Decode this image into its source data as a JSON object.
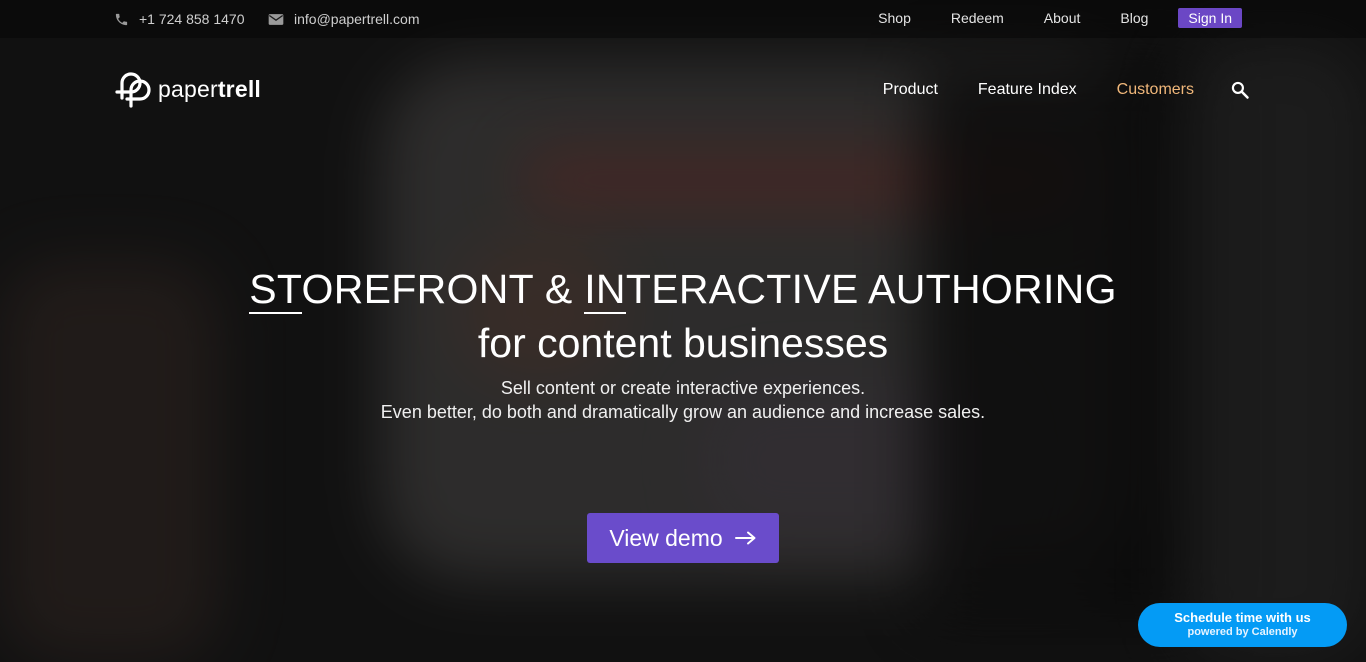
{
  "colors": {
    "accent": "#6a4ccb",
    "active_nav": "#f0b77a",
    "calendly": "#049bf5"
  },
  "topbar": {
    "phone": {
      "icon": "phone-icon",
      "text": "+1 724 858 1470"
    },
    "email": {
      "icon": "mail-icon",
      "text": "info@papertrell.com"
    },
    "links": [
      "Shop",
      "Redeem",
      "About",
      "Blog"
    ],
    "sign_in": "Sign In"
  },
  "nav": {
    "logo_text_light": "paper",
    "logo_text_bold": "trell",
    "items": [
      "Product",
      "Feature Index",
      "Customers"
    ],
    "active_item": "Customers",
    "search_icon": "search-icon"
  },
  "hero": {
    "headline_part1_underlined": "ST",
    "headline_part1_rest": "OREFRONT & ",
    "headline_part2_underlined": "IN",
    "headline_part2_rest": "TERACTIVE AUTHORING",
    "headline_line2": "for content businesses",
    "subtitle_line1": "Sell content or create interactive experiences.",
    "subtitle_line2": "Even better, do both and dramatically grow an audience and increase sales.",
    "cta_label": "View demo",
    "cta_icon": "arrow-right-icon"
  },
  "calendly": {
    "title": "Schedule time with us",
    "subtitle": "powered by Calendly"
  }
}
